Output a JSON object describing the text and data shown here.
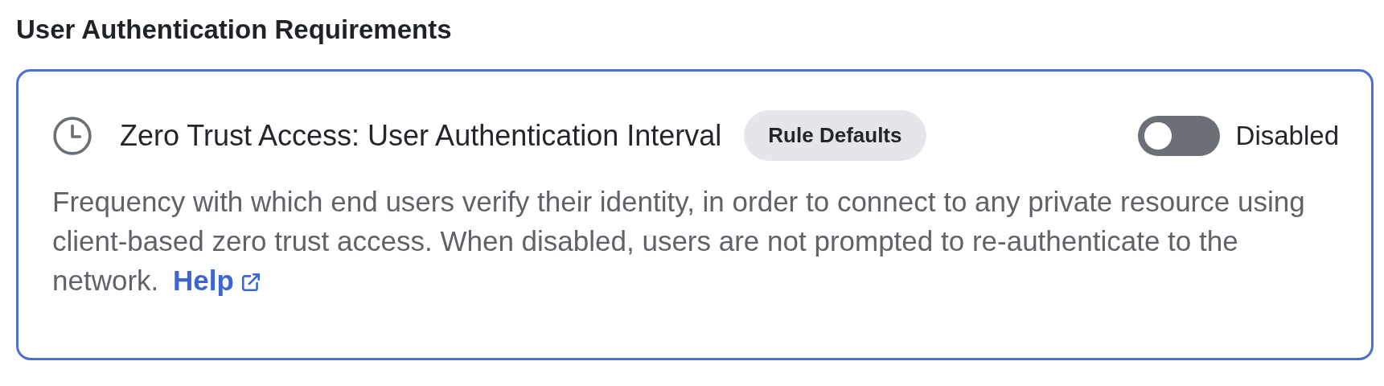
{
  "section_title": "User Authentication Requirements",
  "setting": {
    "title": "Zero Trust Access: User Authentication Interval",
    "badge": "Rule Defaults",
    "toggle": {
      "on": false,
      "label": "Disabled"
    },
    "description": "Frequency with which end users verify their identity, in order to connect to any private resource using client-based zero trust access. When disabled, users are not prompted to re-authenticate to the network.",
    "help_link": "Help"
  }
}
